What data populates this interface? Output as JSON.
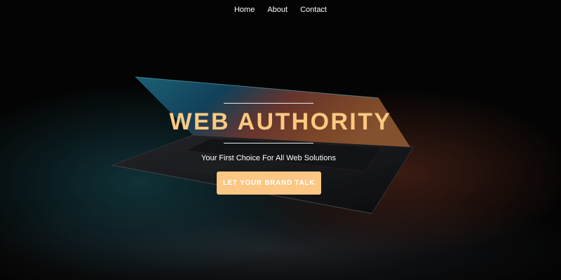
{
  "nav": {
    "items": [
      {
        "label": "Home"
      },
      {
        "label": "About"
      },
      {
        "label": "Contact"
      }
    ]
  },
  "hero": {
    "title": "WEB AUTHORITY",
    "subtitle": "Your First Choice For All Web Solutions",
    "cta_label": "LET YOUR BRAND TALK"
  },
  "theme": {
    "accent": "#fcc980",
    "background": "#070707",
    "text": "#ffffff"
  }
}
